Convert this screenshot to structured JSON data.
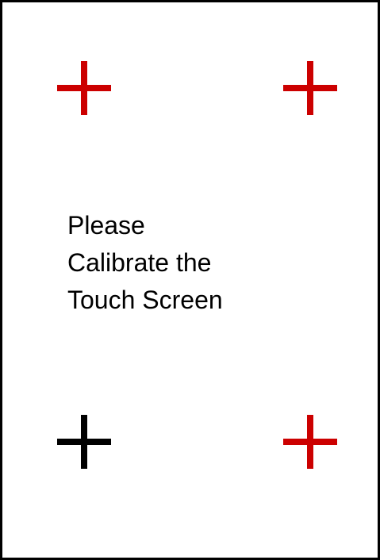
{
  "message": {
    "lines": [
      "Please",
      "Calibrate the",
      "Touch Screen"
    ]
  },
  "targets": [
    {
      "id": "top-left",
      "state": "pending",
      "color": "#cc0000",
      "icon": "crosshair-icon"
    },
    {
      "id": "top-right",
      "state": "pending",
      "color": "#cc0000",
      "icon": "crosshair-icon"
    },
    {
      "id": "bottom-left",
      "state": "active",
      "color": "#000000",
      "icon": "crosshair-icon"
    },
    {
      "id": "bottom-right",
      "state": "pending",
      "color": "#cc0000",
      "icon": "crosshair-icon"
    }
  ],
  "colors": {
    "background": "#ffffff",
    "border": "#000000",
    "text": "#000000"
  }
}
